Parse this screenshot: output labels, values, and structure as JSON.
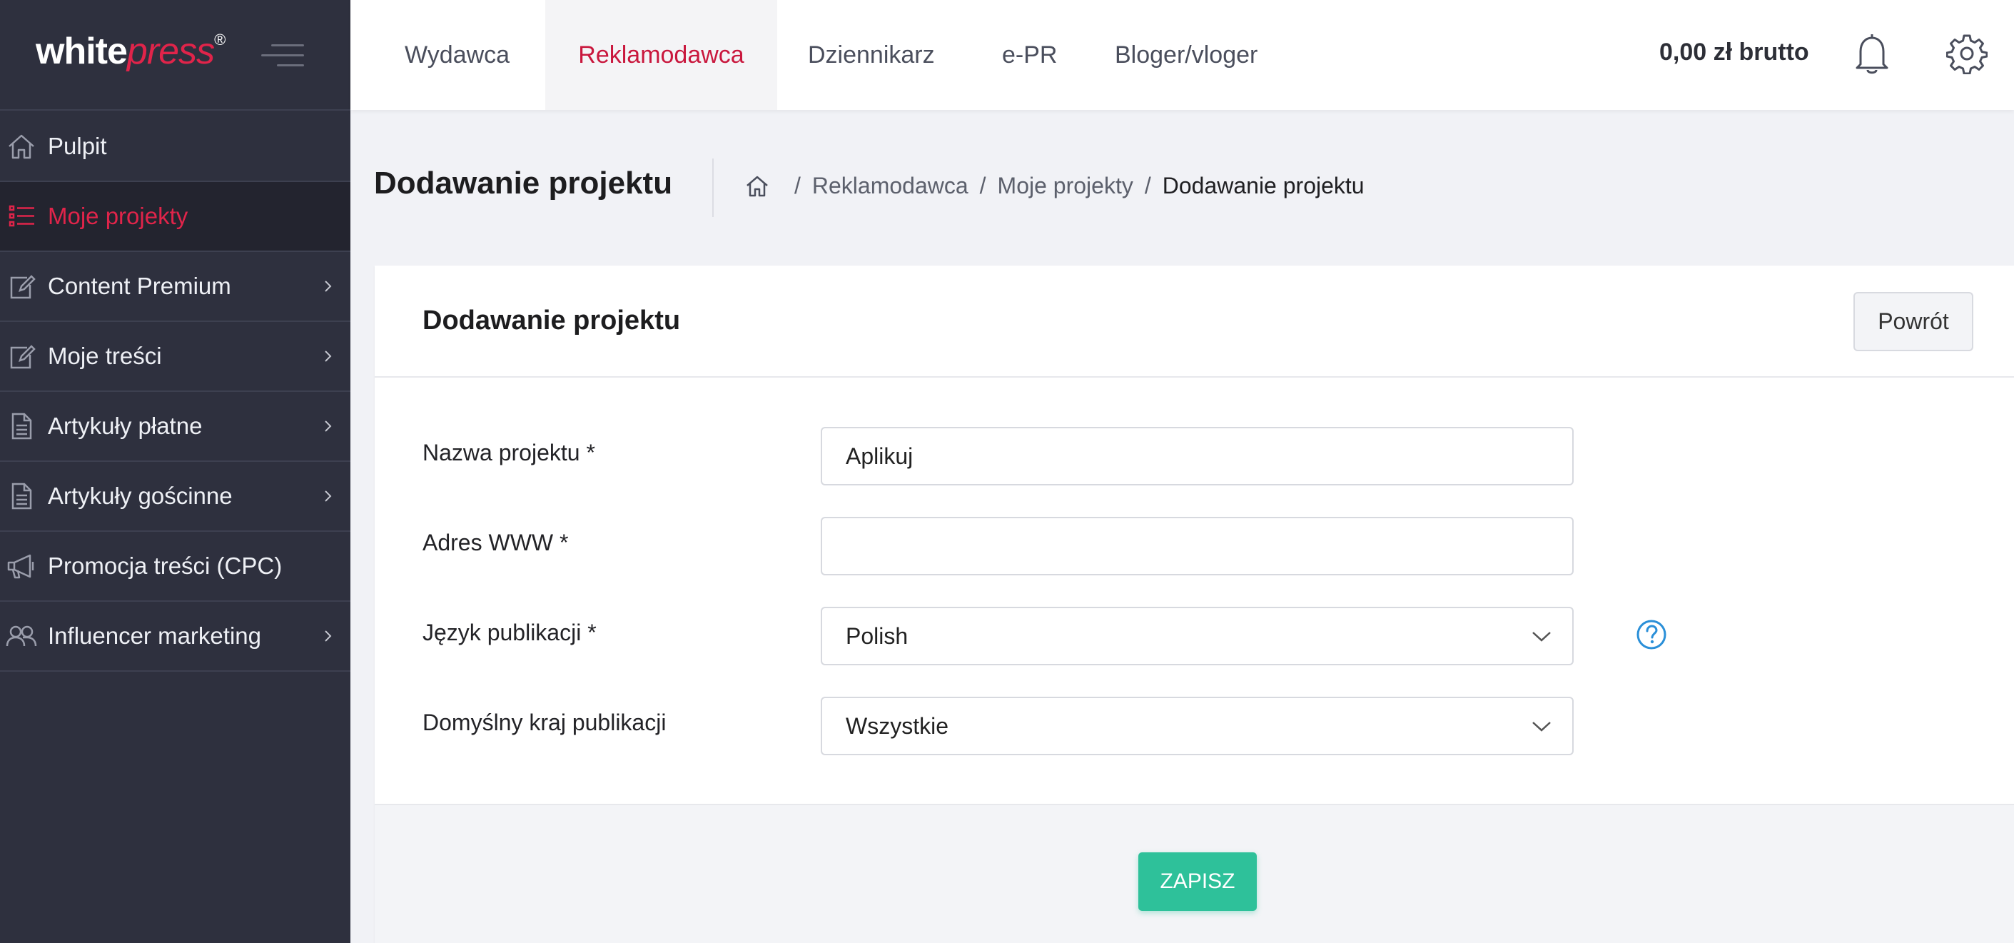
{
  "brand": {
    "part1": "white",
    "part2": "press",
    "mark": "®"
  },
  "sidebar": {
    "items": [
      {
        "label": "Pulpit",
        "icon": "home-icon",
        "active": false,
        "has_submenu": false
      },
      {
        "label": "Moje projekty",
        "icon": "list-icon",
        "active": true,
        "has_submenu": false
      },
      {
        "label": "Content Premium",
        "icon": "edit-icon",
        "active": false,
        "has_submenu": true
      },
      {
        "label": "Moje treści",
        "icon": "edit-icon",
        "active": false,
        "has_submenu": true
      },
      {
        "label": "Artykuły płatne",
        "icon": "document-icon",
        "active": false,
        "has_submenu": true
      },
      {
        "label": "Artykuły gościnne",
        "icon": "document-icon",
        "active": false,
        "has_submenu": true
      },
      {
        "label": "Promocja treści (CPC)",
        "icon": "megaphone-icon",
        "active": false,
        "has_submenu": false
      },
      {
        "label": "Influencer marketing",
        "icon": "users-icon",
        "active": false,
        "has_submenu": true
      }
    ]
  },
  "topnav": {
    "tabs": [
      {
        "label": "Wydawca",
        "active": false
      },
      {
        "label": "Reklamodawca",
        "active": true
      },
      {
        "label": "Dziennikarz",
        "active": false
      },
      {
        "label": "e-PR",
        "active": false
      },
      {
        "label": "Bloger/vloger",
        "active": false
      }
    ],
    "balance": "0,00 zł brutto"
  },
  "page": {
    "title": "Dodawanie projektu",
    "breadcrumb": [
      "Reklamodawca",
      "Moje projekty",
      "Dodawanie projektu"
    ]
  },
  "card": {
    "title": "Dodawanie projektu",
    "back_label": "Powrót"
  },
  "form": {
    "project_name": {
      "label": "Nazwa projektu *",
      "value": "Aplikuj"
    },
    "website": {
      "label": "Adres WWW *",
      "value": ""
    },
    "language": {
      "label": "Język publikacji *",
      "value": "Polish"
    },
    "country": {
      "label": "Domyślny kraj publikacji",
      "value": "Wszystkie"
    },
    "save_label": "ZAPISZ"
  },
  "colors": {
    "accent": "#c9173d",
    "sidebar_bg": "#2e303e",
    "save": "#2ec19a",
    "help": "#2a8fd8"
  }
}
